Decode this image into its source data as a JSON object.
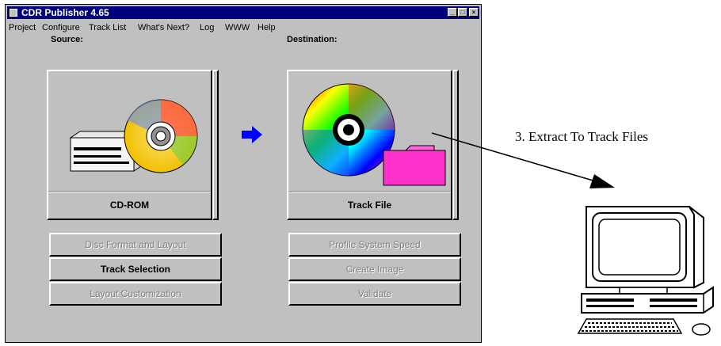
{
  "window": {
    "title": "CDR Publisher 4.65",
    "controls": [
      "minimize",
      "maximize",
      "close"
    ]
  },
  "menu": [
    "Project",
    "Configure",
    "Track List",
    "What's Next?",
    "Log",
    "WWW",
    "Help"
  ],
  "source": {
    "label": "Source:",
    "device_label": "CD-ROM",
    "icon": "cdrom-drive-icon"
  },
  "destination": {
    "label": "Destination:",
    "device_label": "Track File",
    "icon": "track-file-icon"
  },
  "arrow_icon": "right-arrow-icon",
  "left_buttons": [
    {
      "label": "Disc Format and Layout",
      "enabled": false
    },
    {
      "label": "Track Selection",
      "enabled": true
    },
    {
      "label": "Layout Customization",
      "enabled": false
    }
  ],
  "right_buttons": [
    {
      "label": "Profile System Speed",
      "enabled": false
    },
    {
      "label": "Create Image",
      "enabled": false
    },
    {
      "label": "Validate",
      "enabled": false
    }
  ],
  "annotation": {
    "text": "3. Extract To Track Files",
    "icon": "desktop-computer-icon"
  },
  "colors": {
    "titlebar": "#00007b",
    "window_bg": "#c0c0c0",
    "arrow": "#0000ff",
    "folder": "#ff33cc"
  }
}
